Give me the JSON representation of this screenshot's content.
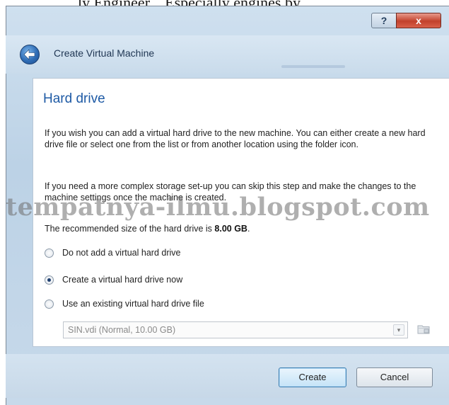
{
  "caption_fragment": "ly Engineer, . Especially engines by",
  "window": {
    "title": "Create Virtual Machine",
    "help_glyph": "?",
    "close_glyph": "x"
  },
  "page": {
    "title": "Hard drive",
    "paragraph1": "If you wish you can add a virtual hard drive to the new machine. You can either create a new hard drive file or select one from the list or from another location using the folder icon.",
    "paragraph2": "If you need a more complex storage set-up you can skip this step and make the changes to the machine settings once the machine is created.",
    "recommend_prefix": "The recommended size of the hard drive is ",
    "recommend_size": "8.00 GB",
    "recommend_suffix": "."
  },
  "options": [
    {
      "label": "Do not add a virtual hard drive",
      "selected": false
    },
    {
      "label": "Create a virtual hard drive now",
      "selected": true
    },
    {
      "label": "Use an existing virtual hard drive file",
      "selected": false
    }
  ],
  "existing_file": {
    "value": "SIN.vdi (Normal, 10.00 GB)",
    "enabled": false
  },
  "buttons": {
    "create": "Create",
    "cancel": "Cancel"
  },
  "watermark": "tempatnya-ilmu.blogspot.com",
  "icons": {
    "back": "back-arrow-icon",
    "folder": "folder-icon",
    "dropdown": "chevron-down-icon"
  },
  "colors": {
    "title_blue": "#1e5aa5",
    "close_red": "#c2412c",
    "window_frame": "#c7d9ea"
  }
}
